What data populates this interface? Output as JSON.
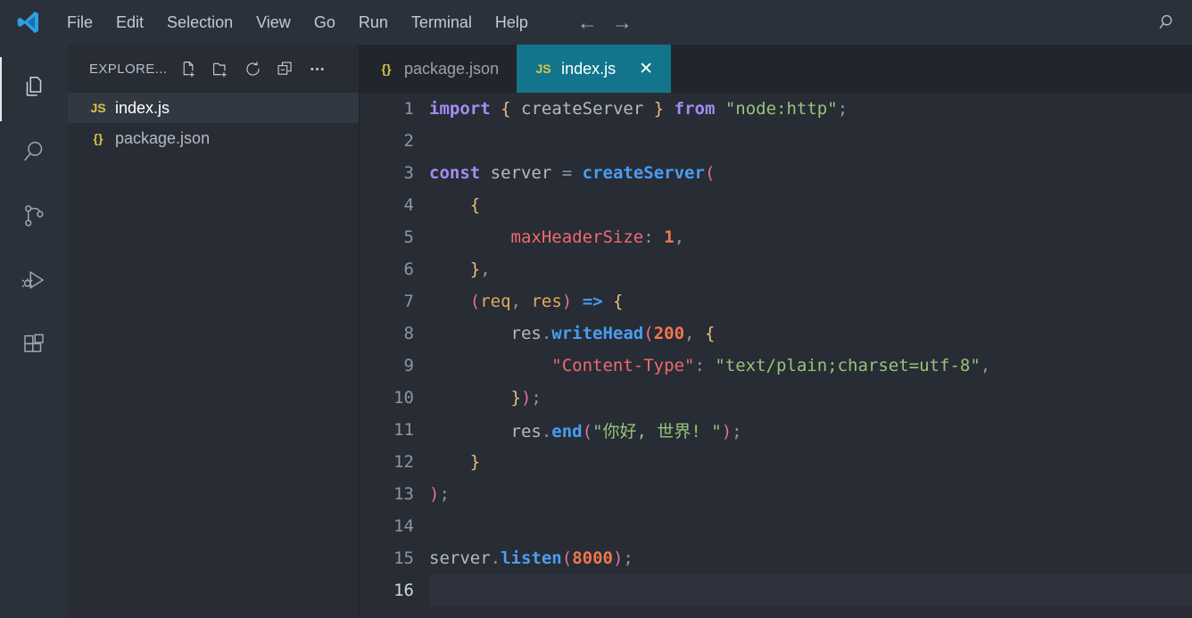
{
  "titlebar": {
    "logo_icon": "vscode-logo-icon",
    "menus": [
      {
        "label": "File"
      },
      {
        "label": "Edit"
      },
      {
        "label": "Selection"
      },
      {
        "label": "View"
      },
      {
        "label": "Go"
      },
      {
        "label": "Run"
      },
      {
        "label": "Terminal"
      },
      {
        "label": "Help"
      }
    ],
    "back_icon": "arrow-left-icon",
    "forward_icon": "arrow-right-icon",
    "search_icon": "search-icon"
  },
  "activitybar": {
    "items": [
      {
        "name": "explorer",
        "icon": "files-icon",
        "active": true
      },
      {
        "name": "search",
        "icon": "search-icon",
        "active": false
      },
      {
        "name": "source-control",
        "icon": "source-control-icon",
        "active": false
      },
      {
        "name": "run-and-debug",
        "icon": "run-debug-icon",
        "active": false
      },
      {
        "name": "extensions",
        "icon": "extensions-icon",
        "active": false
      }
    ]
  },
  "sidebar": {
    "title": "EXPLORE...",
    "actions": [
      {
        "name": "new-file",
        "icon": "new-file-icon"
      },
      {
        "name": "new-folder",
        "icon": "new-folder-icon"
      },
      {
        "name": "refresh",
        "icon": "refresh-icon"
      },
      {
        "name": "collapse-all",
        "icon": "collapse-all-icon"
      },
      {
        "name": "more-actions",
        "icon": "ellipsis-icon"
      }
    ],
    "files": [
      {
        "name": "index.js",
        "icon_label": "JS",
        "icon_color": "#d8c545",
        "selected": true
      },
      {
        "name": "package.json",
        "icon_label": "{}",
        "icon_color": "#d8c545",
        "selected": false
      }
    ]
  },
  "tabs": [
    {
      "label": "package.json",
      "icon_label": "{}",
      "icon_color": "#d8c545",
      "active": false,
      "closable": false
    },
    {
      "label": "index.js",
      "icon_label": "JS",
      "icon_color": "#d8c545",
      "active": true,
      "closable": true,
      "close_icon": "close-icon"
    }
  ],
  "editor": {
    "active_line": 16,
    "language": "javascript",
    "lines": [
      {
        "n": "1",
        "text": "import { createServer } from \"node:http\";"
      },
      {
        "n": "2",
        "text": ""
      },
      {
        "n": "3",
        "text": "const server = createServer("
      },
      {
        "n": "4",
        "text": "    {"
      },
      {
        "n": "5",
        "text": "        maxHeaderSize: 1,"
      },
      {
        "n": "6",
        "text": "    },"
      },
      {
        "n": "7",
        "text": "    (req, res) => {"
      },
      {
        "n": "8",
        "text": "        res.writeHead(200, {"
      },
      {
        "n": "9",
        "text": "            \"Content-Type\": \"text/plain;charset=utf-8\","
      },
      {
        "n": "10",
        "text": "        });"
      },
      {
        "n": "11",
        "text": "        res.end(\"你好, 世界! \");"
      },
      {
        "n": "12",
        "text": "    }"
      },
      {
        "n": "13",
        "text": ");"
      },
      {
        "n": "14",
        "text": ""
      },
      {
        "n": "15",
        "text": "server.listen(8000);"
      },
      {
        "n": "16",
        "text": ""
      }
    ]
  },
  "colors": {
    "background": "#272c35",
    "chrome": "#2b313b",
    "tabbar": "#21252c",
    "active_tab": "#12758c",
    "selection": "#323842",
    "active_line": "#2e323d",
    "keyword": "#a48cf2",
    "function": "#4a9df0",
    "string": "#98c379",
    "number": "#f2774e",
    "property": "#ef6a6e",
    "brace": "#e5c07b",
    "paren": "#e0719d",
    "param": "#e5a95c",
    "text": "#b4bac4",
    "line_number": "#8d95a3"
  }
}
